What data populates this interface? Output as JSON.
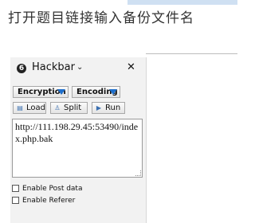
{
  "page": {
    "heading": "打开题目链接输入备份文件名"
  },
  "hackbar": {
    "logo_glyph": "❻",
    "title": "Hackbar",
    "title_chevron": "⌄",
    "close_glyph": "✕",
    "menus": {
      "encryption": "Encryption",
      "encoding": "Encoding"
    },
    "buttons": {
      "load": "Load",
      "split": "Split",
      "run": "Run"
    },
    "url_value": "http://111.198.29.45:53490/index.php.bak",
    "options": {
      "post_data": "Enable Post data",
      "referer": "Enable Referer"
    }
  },
  "colors": {
    "dropdown_arrow": "#1e6fcc",
    "panel_bg": "#f2f2f2",
    "top_tab": "#cfe0f2"
  }
}
